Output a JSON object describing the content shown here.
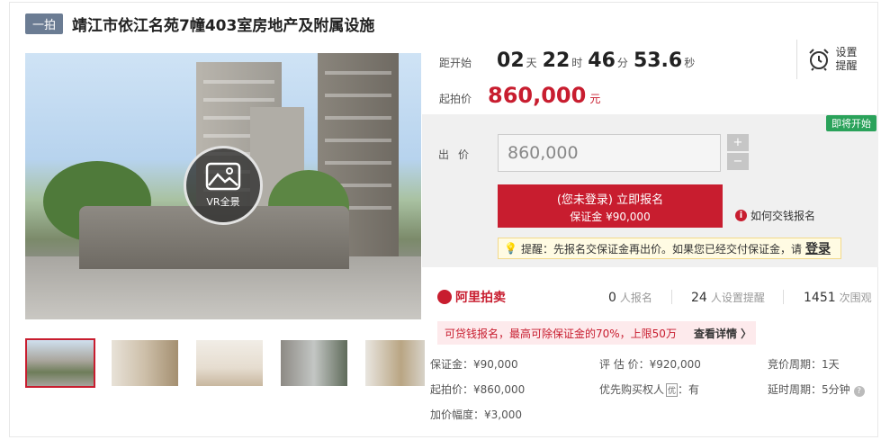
{
  "header": {
    "tag": "一拍",
    "title": "靖江市依江名苑7幢403室房地产及附属设施"
  },
  "gallery": {
    "vr_label": "VR全景",
    "thumbnails": [
      "thumb-1",
      "thumb-2",
      "thumb-3",
      "thumb-4",
      "thumb-5"
    ]
  },
  "countdown": {
    "label": "距开始",
    "days": "02",
    "days_unit": "天",
    "hours": "22",
    "hours_unit": "时",
    "minutes": "46",
    "minutes_unit": "分",
    "seconds": "53.6",
    "seconds_unit": "秒"
  },
  "remind": {
    "label": "设置提醒",
    "icon": "alarm-clock-icon"
  },
  "start_price": {
    "label": "起拍价",
    "value": "860,000",
    "unit": "元"
  },
  "bid": {
    "status_badge": "即将开始",
    "label": "出价",
    "input_value": "860,000",
    "plus": "+",
    "minus": "−",
    "signup_line1": "(您未登录) 立即报名",
    "signup_line2": "保证金 ¥90,000",
    "how_to_pay": "如何交钱报名",
    "notice_text": "提醒：先报名交保证金再出价。如果您已经交付保证金，请",
    "notice_login": "登录"
  },
  "stats": {
    "brand": "阿里拍卖",
    "signups": "0",
    "signups_label": "人报名",
    "reminders": "24",
    "reminders_label": "人设置提醒",
    "views": "1451",
    "views_label": "次围观"
  },
  "loan": {
    "text": "可贷钱报名，最高可除保证金的70%，上限50万",
    "link": "查看详情 〉"
  },
  "details": {
    "deposit": "保证金：¥90,000",
    "appraisal": "评 估 价：¥920,000",
    "cycle": "竞价周期：1天",
    "start": "起拍价：¥860,000",
    "priority": "优先购买权人",
    "priority_tag": "优",
    "priority_value": "：有",
    "delay": "延时周期：5分钟",
    "increment": "加价幅度：¥3,000"
  },
  "colors": {
    "accent": "#c81d2f",
    "badge": "#2aa25a"
  }
}
